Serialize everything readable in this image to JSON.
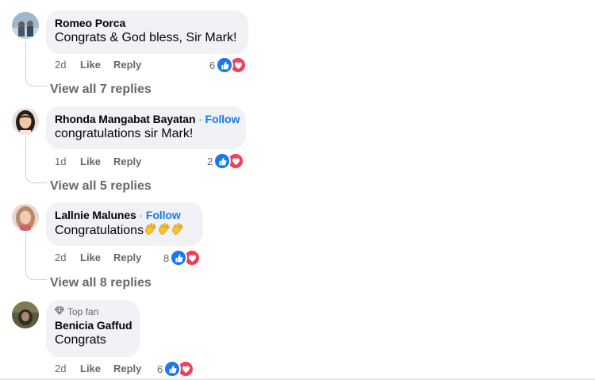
{
  "comments": [
    {
      "author": "Romeo Porca",
      "follow": "",
      "text": "Congrats & God bless, Sir Mark!",
      "time": "2d",
      "like_label": "Like",
      "reply_label": "Reply",
      "reaction_count": "6",
      "view_replies": "View all 7 replies"
    },
    {
      "author": "Rhonda Mangabat Bayatan",
      "follow_sep": " · ",
      "follow": "Follow",
      "text": "congratulations sir Mark!",
      "time": "1d",
      "like_label": "Like",
      "reply_label": "Reply",
      "reaction_count": "2",
      "view_replies": "View all 5 replies"
    },
    {
      "author": "Lallnie Malunes",
      "follow_sep": " · ",
      "follow": "Follow",
      "text": "Congratulations",
      "time": "2d",
      "like_label": "Like",
      "reply_label": "Reply",
      "reaction_count": "8",
      "view_replies": "View all 8 replies"
    },
    {
      "badge": "Top fan",
      "author": "Benicia Gaffud",
      "text": "Congrats",
      "time": "2d",
      "like_label": "Like",
      "reply_label": "Reply",
      "reaction_count": "6"
    }
  ],
  "colors": {
    "bubble": "#f0f2f5",
    "secondary_text": "#65676b",
    "follow_link": "#1877f2",
    "like_reaction": "#1877f2",
    "love_reaction": "#f33e58"
  },
  "icons": [
    "avatar",
    "like-reaction-icon",
    "love-reaction-icon",
    "clapping-hands-emoji",
    "top-fan-diamond-icon"
  ]
}
